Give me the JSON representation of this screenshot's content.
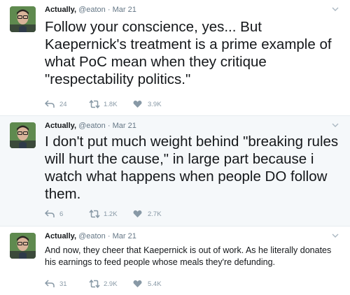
{
  "tweets": [
    {
      "name": "Actually,",
      "handle": "@eaton",
      "separator": "·",
      "date": "Mar 21",
      "text": "Follow your conscience, yes... But Kaepernick's treatment is a prime example of what PoC mean when they critique \"respectability politics.\"",
      "replies": "24",
      "retweets": "1.8K",
      "likes": "3.9K"
    },
    {
      "name": "Actually,",
      "handle": "@eaton",
      "separator": "·",
      "date": "Mar 21",
      "text": "I don't put much weight behind \"breaking rules will hurt the cause,\" in large part because i watch what happens when people DO follow them.",
      "replies": "6",
      "retweets": "1.2K",
      "likes": "2.7K"
    },
    {
      "name": "Actually,",
      "handle": "@eaton",
      "separator": "·",
      "date": "Mar 21",
      "text": "And now, they cheer that Kaepernick is out of work. As he literally donates his earnings to feed people whose meals they're defunding.",
      "replies": "31",
      "retweets": "2.9K",
      "likes": "5.4K"
    }
  ],
  "icons": {
    "reply": "reply-icon",
    "retweet": "retweet-icon",
    "like": "heart-icon",
    "more": "chevron-down-icon"
  },
  "colors": {
    "text": "#14171a",
    "meta": "#657786",
    "action": "#8899a6",
    "highlight_bg": "#f5f8fa",
    "divider": "#e6ecf0"
  }
}
